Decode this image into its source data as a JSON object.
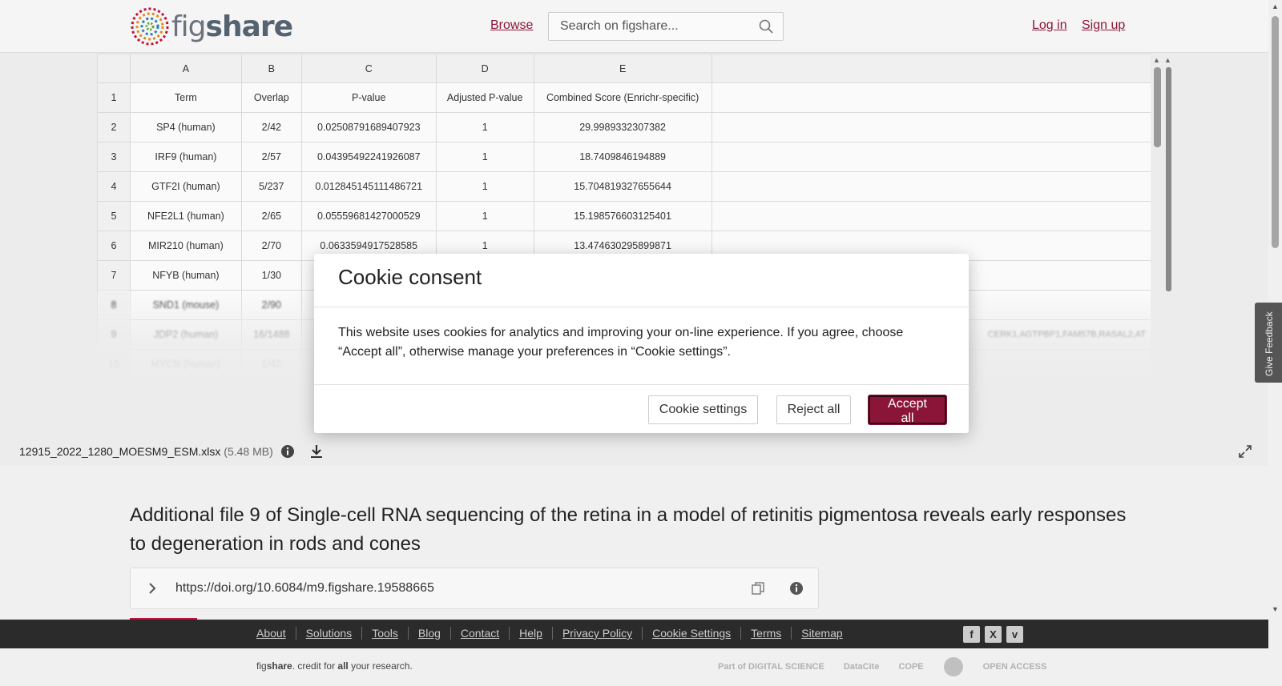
{
  "header": {
    "logo_text_fig": "fig",
    "logo_text_share": "share",
    "browse": "Browse",
    "search_placeholder": "Search on figshare...",
    "login": "Log in",
    "signup": "Sign up"
  },
  "sheet": {
    "columns": [
      "A",
      "B",
      "C",
      "D",
      "E"
    ],
    "rows": [
      {
        "n": "1",
        "cells": [
          "Term",
          "Overlap",
          "P-value",
          "Adjusted P-value",
          "Combined Score (Enrichr-specific)"
        ]
      },
      {
        "n": "2",
        "cells": [
          "SP4 (human)",
          "2/42",
          "0.02508791689407923",
          "1",
          "29.9989332307382"
        ]
      },
      {
        "n": "3",
        "cells": [
          "IRF9 (human)",
          "2/57",
          "0.04395492241926087",
          "1",
          "18.7409846194889"
        ]
      },
      {
        "n": "4",
        "cells": [
          "GTF2I (human)",
          "5/237",
          "0.012845145111486721",
          "1",
          "15.704819327655644"
        ]
      },
      {
        "n": "5",
        "cells": [
          "NFE2L1 (human)",
          "2/65",
          "0.05559681427000529",
          "1",
          "15.198576603125401"
        ]
      },
      {
        "n": "6",
        "cells": [
          "MIR210 (human)",
          "2/70",
          "0.0633594917528585",
          "1",
          "13.474630295899871"
        ]
      },
      {
        "n": "7",
        "cells": [
          "NFYB (human)",
          "1/30",
          "",
          "",
          ""
        ]
      },
      {
        "n": "8",
        "cells": [
          "SND1 (mouse)",
          "2/90",
          "",
          "",
          ""
        ]
      },
      {
        "n": "9",
        "cells": [
          "JDP2 (human)",
          "16/1488",
          "",
          "",
          ""
        ]
      },
      {
        "n": "10",
        "cells": [
          "MYCN (human)",
          "1/42",
          "",
          "",
          ""
        ]
      }
    ],
    "row9_extra": "CERK1,AGTPBP1,FAM57B,RASAL2,AT"
  },
  "file": {
    "name": "12915_2022_1280_MOESM9_ESM.xlsx",
    "size": "(5.48 MB)"
  },
  "article": {
    "title": "Additional file 9 of Single-cell RNA sequencing of the retina in a model of retinitis pigmentosa reveals early responses to degeneration in rods and cones",
    "doi": "https://doi.org/10.6084/m9.figshare.19588665"
  },
  "footer": {
    "links": [
      "About",
      "Solutions",
      "Tools",
      "Blog",
      "Contact",
      "Help",
      "Privacy Policy",
      "Cookie Settings",
      "Terms",
      "Sitemap"
    ],
    "credit_fig": "fig",
    "credit_share": "share",
    "credit_rest1": ". credit for ",
    "credit_all": "all",
    "credit_rest2": " your research.",
    "partners": [
      "Part of DIGITAL SCIENCE",
      "DataCite",
      "COPE",
      "",
      "OPEN ACCESS"
    ]
  },
  "feedback": "Give Feedback",
  "modal": {
    "title": "Cookie consent",
    "body": "This website uses cookies for analytics and improving your on-line experience. If you agree, choose “Accept all”, otherwise manage your preferences in “Cookie settings”.",
    "settings": "Cookie settings",
    "reject": "Reject all",
    "accept": "Accept all"
  },
  "colors": {
    "brand": "#8b1538",
    "footer_bg": "#2b2b2b"
  }
}
